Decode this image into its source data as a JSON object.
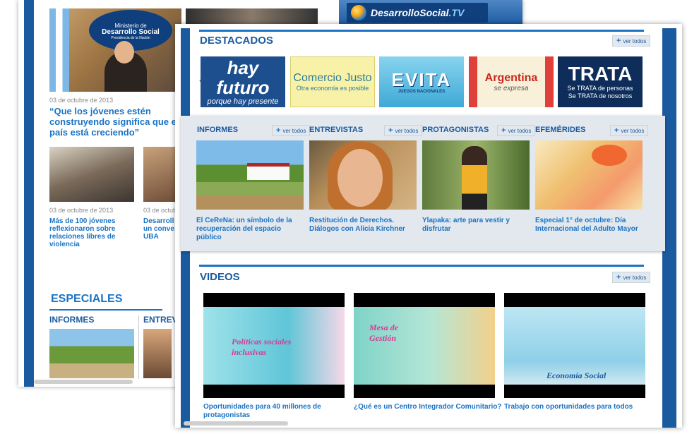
{
  "back_page": {
    "tv_logo": {
      "text": "DesarrolloSocial",
      "suffix": ".TV"
    },
    "podium": {
      "line1": "Ministerio de",
      "line2": "Desarrollo Social",
      "line3": "Presidencia de la Nación"
    },
    "main_news": {
      "date": "03 de octubre de 2013",
      "headline": "“Que los jóvenes estén construyendo significa que el país está creciendo”"
    },
    "news": [
      {
        "date": "03 de octubre de 2013",
        "headline": "Más de 100 jóvenes reflexionaron sobre relaciones libres de violencia"
      },
      {
        "date": "03 de octubr",
        "headline": "Desarroll un conve UBA"
      }
    ],
    "especiales": {
      "title": "ESPECIALES",
      "informes": "INFORMES",
      "entrevistas": "ENTREV"
    }
  },
  "front_page": {
    "destacados": {
      "title": "DESTACADOS",
      "ver_todos": "ver todos",
      "banners": {
        "hay_futuro": {
          "l1": "hay futuro",
          "l2": "porque hay presente"
        },
        "comercio": {
          "l1": "Comercio Justo",
          "l2": "Otra economía es posible"
        },
        "evita": {
          "l1": "EVITA",
          "l2": "JUEGOS NACIONALES"
        },
        "argentina": {
          "l1": "Argentina",
          "l2": "se expresa"
        },
        "trata": {
          "l1": "TRATA",
          "l2": "Se TRATA de personas",
          "l3": "Se TRATA de nosotros"
        }
      }
    },
    "categories": [
      {
        "title": "INFORMES",
        "text": "El CeReNa: un símbolo de la recuperación del espacio público"
      },
      {
        "title": "ENTREVISTAS",
        "text": "Restitución de Derechos. Diálogos con Alicia Kirchner"
      },
      {
        "title": "PROTAGONISTAS",
        "text": "Ylapaka: arte para vestir y disfrutar"
      },
      {
        "title": "EFEMÉRIDES",
        "text": "Especial 1° de octubre: Día Internacional del Adulto Mayor"
      }
    ],
    "videos": {
      "title": "VIDEOS",
      "ver_todos": "ver todos",
      "items": [
        {
          "caption": "Políticas sociales inclusivas",
          "text": "Oportunidades para 40 millones de protagonistas"
        },
        {
          "caption": "Mesa de Gestión",
          "text": "¿Qué es un Centro Integrador Comunitario?"
        },
        {
          "caption": "Economía Social",
          "text": "Trabajo con oportunidades para todos"
        }
      ]
    },
    "arrows": {
      "prev": "‹",
      "next": "›"
    }
  },
  "colors": {
    "accent": "#1a5a9e",
    "link": "#1a73c4",
    "panel": "#e2e8ee"
  }
}
